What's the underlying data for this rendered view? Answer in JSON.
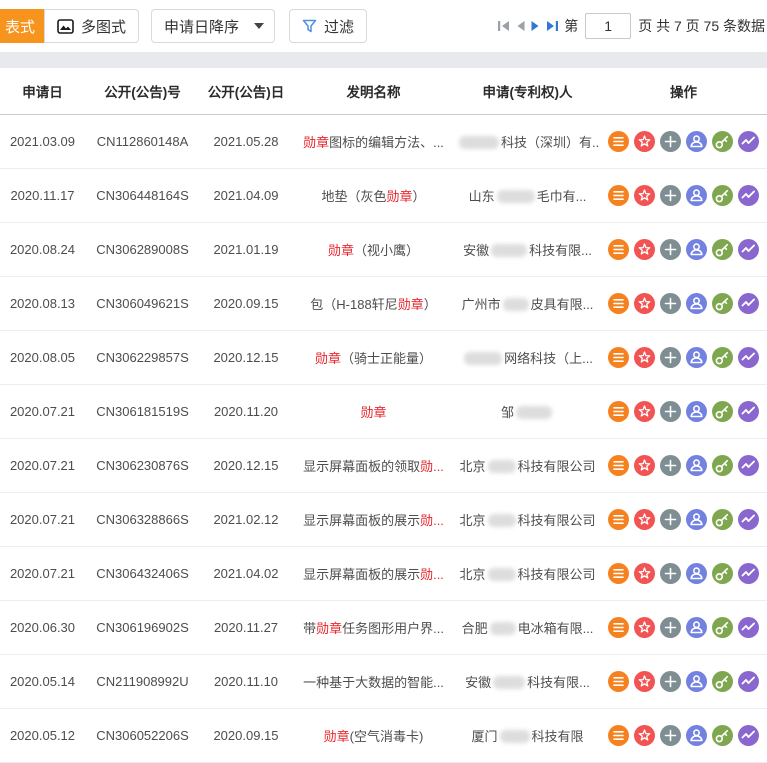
{
  "toolbar": {
    "table_view_label": "表式",
    "multi_view_label": "多图式",
    "sort_label": "申请日降序",
    "filter_label": "过滤"
  },
  "pagination": {
    "page_prefix": "第",
    "current_page": "1",
    "page_suffix": "页 共 7 页 75 条数据"
  },
  "colors": {
    "accent_orange": "#f7941e",
    "red_highlight": "#e8262d",
    "pager_active_blue": "#2e7ad1",
    "pager_disabled_gray": "#9aa1a8",
    "filter_icon_blue": "#4d8fe0"
  },
  "table": {
    "headers": [
      "申请日",
      "公开(公告)号",
      "公开(公告)日",
      "发明名称",
      "申请(专利权)人",
      "操作"
    ],
    "action_icons": [
      {
        "icon": "list",
        "name": "detail-button",
        "color": "#F5821F"
      },
      {
        "icon": "star",
        "name": "favorite-button",
        "color": "#F15453"
      },
      {
        "icon": "plus",
        "name": "add-button",
        "color": "#7E8E92"
      },
      {
        "icon": "user",
        "name": "applicant-button",
        "color": "#7381E0"
      },
      {
        "icon": "key",
        "name": "legal-status-button",
        "color": "#7EA74F"
      },
      {
        "icon": "trend",
        "name": "analytics-button",
        "color": "#8A67CE"
      }
    ],
    "rows": [
      {
        "date": "2021.03.09",
        "pub_no": "CN112860148A",
        "pub_date": "2021.05.28",
        "title": [
          {
            "t": "勋章",
            "red": true
          },
          {
            "t": "图标的编辑方法、..."
          }
        ],
        "applicant": [
          {
            "blur": 40
          },
          {
            "t": "科技（深圳）有..."
          }
        ]
      },
      {
        "date": "2020.11.17",
        "pub_no": "CN306448164S",
        "pub_date": "2021.04.09",
        "title": [
          {
            "t": "地垫（灰色"
          },
          {
            "t": "勋章",
            "red": true
          },
          {
            "t": "）"
          }
        ],
        "applicant": [
          {
            "t": "山东"
          },
          {
            "blur": 38
          },
          {
            "t": "毛巾有..."
          }
        ]
      },
      {
        "date": "2020.08.24",
        "pub_no": "CN306289008S",
        "pub_date": "2021.01.19",
        "title": [
          {
            "t": "勋章",
            "red": true
          },
          {
            "t": "（视小鹰）"
          }
        ],
        "applicant": [
          {
            "t": "安徽"
          },
          {
            "blur": 36
          },
          {
            "t": "科技有限..."
          }
        ]
      },
      {
        "date": "2020.08.13",
        "pub_no": "CN306049621S",
        "pub_date": "2020.09.15",
        "title": [
          {
            "t": "包（H-188轩尼"
          },
          {
            "t": "勋章",
            "red": true
          },
          {
            "t": "）"
          }
        ],
        "applicant": [
          {
            "t": "广州市"
          },
          {
            "blur": 26
          },
          {
            "t": "皮具有限..."
          }
        ]
      },
      {
        "date": "2020.08.05",
        "pub_no": "CN306229857S",
        "pub_date": "2020.12.15",
        "title": [
          {
            "t": "勋章",
            "red": true
          },
          {
            "t": "（骑士正能量）"
          }
        ],
        "applicant": [
          {
            "blur": 38
          },
          {
            "t": "网络科技（上..."
          }
        ]
      },
      {
        "date": "2020.07.21",
        "pub_no": "CN306181519S",
        "pub_date": "2020.11.20",
        "title": [
          {
            "t": "勋章",
            "red": true
          }
        ],
        "applicant": [
          {
            "t": "邹"
          },
          {
            "blur": 36
          }
        ]
      },
      {
        "date": "2020.07.21",
        "pub_no": "CN306230876S",
        "pub_date": "2020.12.15",
        "title": [
          {
            "t": "显示屏幕面板的领取"
          },
          {
            "t": "勋...",
            "red": true
          }
        ],
        "applicant": [
          {
            "t": "北京"
          },
          {
            "blur": 28
          },
          {
            "t": "科技有限公司"
          }
        ]
      },
      {
        "date": "2020.07.21",
        "pub_no": "CN306328866S",
        "pub_date": "2021.02.12",
        "title": [
          {
            "t": "显示屏幕面板的展示"
          },
          {
            "t": "勋...",
            "red": true
          }
        ],
        "applicant": [
          {
            "t": "北京"
          },
          {
            "blur": 28
          },
          {
            "t": "科技有限公司"
          }
        ]
      },
      {
        "date": "2020.07.21",
        "pub_no": "CN306432406S",
        "pub_date": "2021.04.02",
        "title": [
          {
            "t": "显示屏幕面板的展示"
          },
          {
            "t": "勋...",
            "red": true
          }
        ],
        "applicant": [
          {
            "t": "北京"
          },
          {
            "blur": 28
          },
          {
            "t": "科技有限公司"
          }
        ]
      },
      {
        "date": "2020.06.30",
        "pub_no": "CN306196902S",
        "pub_date": "2020.11.27",
        "title": [
          {
            "t": "带"
          },
          {
            "t": "勋章",
            "red": true
          },
          {
            "t": "任务图形用户界..."
          }
        ],
        "applicant": [
          {
            "t": "合肥"
          },
          {
            "blur": 26
          },
          {
            "t": "电冰箱有限..."
          }
        ]
      },
      {
        "date": "2020.05.14",
        "pub_no": "CN211908992U",
        "pub_date": "2020.11.10",
        "title": [
          {
            "t": "一种基于大数据的智能..."
          }
        ],
        "applicant": [
          {
            "t": "安徽"
          },
          {
            "blur": 32
          },
          {
            "t": "科技有限..."
          }
        ]
      },
      {
        "date": "2020.05.12",
        "pub_no": "CN306052206S",
        "pub_date": "2020.09.15",
        "title": [
          {
            "t": "勋章",
            "red": true
          },
          {
            "t": "(空气消毒卡)"
          }
        ],
        "applicant": [
          {
            "t": "厦门"
          },
          {
            "blur": 30
          },
          {
            "t": "科技有限"
          }
        ]
      }
    ]
  }
}
